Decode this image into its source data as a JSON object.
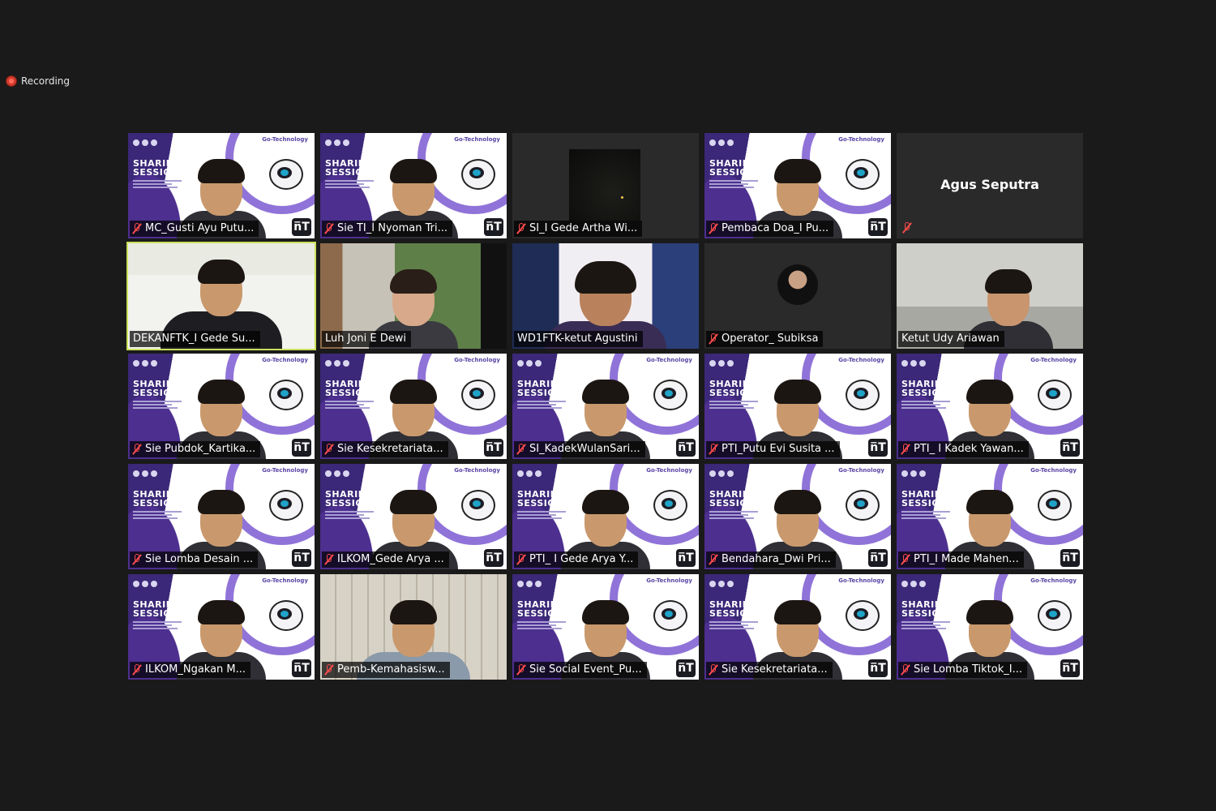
{
  "recording": {
    "label": "Recording"
  },
  "tiles": [
    {
      "name": "MC_Gusti Ayu Putu...",
      "bg": "event",
      "muted": true,
      "active": false
    },
    {
      "name": "Sie TI_I Nyoman Tri...",
      "bg": "event",
      "muted": true,
      "active": false
    },
    {
      "name": "SI_I Gede Artha Wi...",
      "bg": "dark",
      "muted": true,
      "active": false
    },
    {
      "name": "Pembaca Doa_I Pu...",
      "bg": "event",
      "muted": true,
      "active": false
    },
    {
      "name": "",
      "center_name": "Agus Seputra",
      "bg": "none",
      "muted": true,
      "active": false
    },
    {
      "name": "DEKANFTK_I Gede Su...",
      "bg": "home-office",
      "muted": false,
      "active": true
    },
    {
      "name": "Luh Joni E Dewi",
      "bg": "window",
      "muted": false,
      "active": false
    },
    {
      "name": "WD1FTK-ketut Agustini",
      "bg": "city",
      "muted": false,
      "active": false
    },
    {
      "name": "Operator_ Subiksa",
      "bg": "avatar",
      "muted": true,
      "active": false
    },
    {
      "name": "Ketut Udy Ariawan",
      "bg": "room",
      "muted": false,
      "active": false
    },
    {
      "name": "Sie Pubdok_Kartika...",
      "bg": "event",
      "muted": true,
      "active": false
    },
    {
      "name": "Sie Kesekretariata...",
      "bg": "event",
      "muted": true,
      "active": false
    },
    {
      "name": "SI_KadekWulanSari...",
      "bg": "event",
      "muted": true,
      "active": false
    },
    {
      "name": "PTI_Putu Evi Susita ...",
      "bg": "event",
      "muted": true,
      "active": false
    },
    {
      "name": "PTI_ I Kadek Yawan...",
      "bg": "event",
      "muted": true,
      "active": false
    },
    {
      "name": "Sie Lomba Desain ...",
      "bg": "event",
      "muted": true,
      "active": false
    },
    {
      "name": "ILKOM_Gede Arya ...",
      "bg": "event",
      "muted": true,
      "active": false
    },
    {
      "name": "PTI_ I Gede Arya Y...",
      "bg": "event",
      "muted": true,
      "active": false
    },
    {
      "name": "Bendahara_Dwi Pri...",
      "bg": "event",
      "muted": true,
      "active": false
    },
    {
      "name": "PTI_I Made Mahen...",
      "bg": "event",
      "muted": true,
      "active": false
    },
    {
      "name": "ILKOM_Ngakan M...",
      "bg": "event",
      "muted": true,
      "active": false
    },
    {
      "name": "Pemb-Kemahasisw...",
      "bg": "bookshelf",
      "muted": true,
      "active": false
    },
    {
      "name": "Sie Social Event_Pu...",
      "bg": "event",
      "muted": true,
      "active": false
    },
    {
      "name": "Sie Kesekretariata...",
      "bg": "event",
      "muted": true,
      "active": false
    },
    {
      "name": "Sie Lomba Tiktok_I...",
      "bg": "event",
      "muted": true,
      "active": false
    }
  ],
  "event": {
    "tag": "Go-Technology",
    "title_line1": "SHARING",
    "title_line2": "SESSION",
    "mark": "n̅T"
  }
}
